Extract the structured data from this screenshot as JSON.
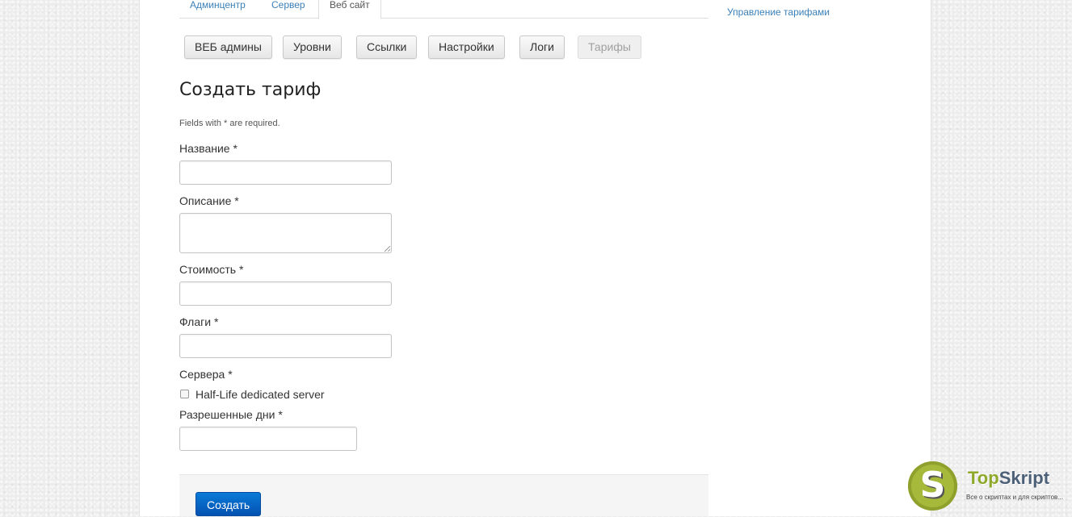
{
  "tabs": [
    {
      "label": "Админцентр"
    },
    {
      "label": "Сервер"
    },
    {
      "label": "Веб сайт"
    }
  ],
  "sidebar": {
    "link": "Управление тарифами"
  },
  "toolbar": {
    "buttons": [
      {
        "label": "ВЕБ админы"
      },
      {
        "label": "Уровни"
      },
      {
        "label": "Ссылки"
      },
      {
        "label": "Настройки"
      },
      {
        "label": "Логи"
      },
      {
        "label": "Тарифы"
      }
    ]
  },
  "form": {
    "title": "Создать тариф",
    "required_note": "Fields with * are required.",
    "name_label": "Название *",
    "description_label": "Описание *",
    "price_label": "Стоимость *",
    "flags_label": "Флаги *",
    "servers_label": "Сервера *",
    "server_option": "Half-Life dedicated server",
    "days_label": "Разрешенные дни *",
    "submit": "Создать"
  },
  "watermark": {
    "letter": "S",
    "brand_part1": "Top",
    "brand_part2": "Skript",
    "tagline": "Все о скриптах и для скриптов..."
  }
}
